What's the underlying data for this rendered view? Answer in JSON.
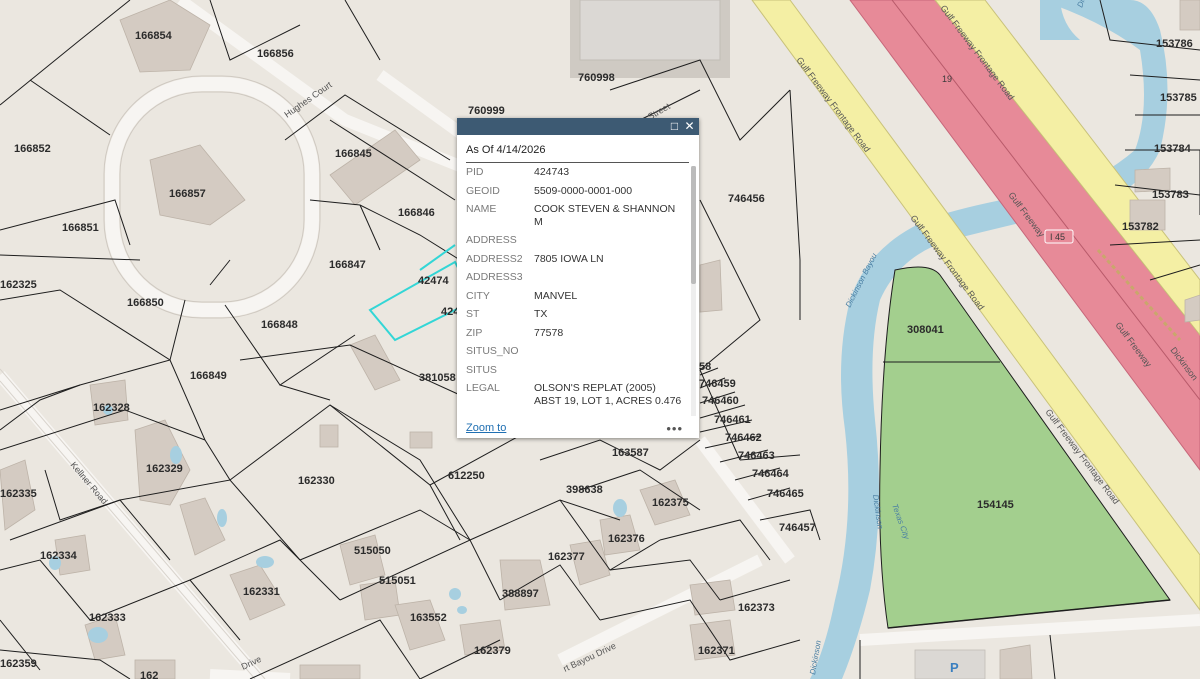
{
  "popup": {
    "title": "As Of 4/14/2026",
    "fields": [
      {
        "key": "PID",
        "value": "424743"
      },
      {
        "key": "GEOID",
        "value": "5509-0000-0001-000"
      },
      {
        "key": "NAME",
        "value": "COOK STEVEN & SHANNON M"
      },
      {
        "key": "ADDRESS",
        "value": ""
      },
      {
        "key": "ADDRESS2",
        "value": "7805 IOWA LN"
      },
      {
        "key": "ADDRESS3",
        "value": ""
      },
      {
        "key": "CITY",
        "value": "MANVEL"
      },
      {
        "key": "ST",
        "value": "TX"
      },
      {
        "key": "ZIP",
        "value": "77578"
      },
      {
        "key": "SITUS_NO",
        "value": ""
      },
      {
        "key": "SITUS",
        "value": ""
      },
      {
        "key": "LEGAL",
        "value": "OLSON'S REPLAT (2005) ABST 19, LOT 1, ACRES 0.476"
      }
    ],
    "zoom_label": "Zoom to",
    "more_label": "•••",
    "maximize_icon": "□",
    "close_icon": "✕"
  },
  "parcels": {
    "p166854": "166854",
    "p166856": "166856",
    "p760998": "760998",
    "p760999": "760999",
    "p166852": "166852",
    "p166857": "166857",
    "p166845": "166845",
    "p166846": "166846",
    "p166851": "166851",
    "p166847": "166847",
    "p162325": "162325",
    "p166850": "166850",
    "p166848": "166848",
    "p42474": "42474",
    "p424": "424",
    "p166849": "166849",
    "p381058": "381058",
    "p162328": "162328",
    "p162329": "162329",
    "p162330": "162330",
    "p162335": "162335",
    "p612250": "612250",
    "p163587": "163587",
    "p398638": "398638",
    "p162375": "162375",
    "p162376": "162376",
    "p162334": "162334",
    "p515050": "515050",
    "p515051": "515051",
    "p162377": "162377",
    "p388897": "388897",
    "p162331": "162331",
    "p162333": "162333",
    "p163552": "163552",
    "p162373": "162373",
    "p162379": "162379",
    "p162371": "162371",
    "p162359": "162359",
    "p162": "162",
    "p746456": "746456",
    "p58": "58",
    "p746459": "746459",
    "p746460": "746460",
    "p746461": "746461",
    "p746462": "746462",
    "p746463": "746463",
    "p746464": "746464",
    "p746465": "746465",
    "p746457": "746457",
    "p308041": "308041",
    "p154145": "154145",
    "p153786": "153786",
    "p153785": "153785",
    "p153784": "153784",
    "p153783": "153783",
    "p153782": "153782"
  },
  "roads": {
    "hughes_court": "Hughes Court",
    "kellner_road": "Kellner Road",
    "frontage_1": "Gulf Freeway Frontage Road",
    "frontage_2": "Gulf Freeway Frontage Road",
    "frontage_3": "Gulf Freeway Frontage Road",
    "frontage_4": "Gulf Freeway Frontage Road",
    "gulf_freeway": "Gulf Freeway",
    "gulf_freeway_2": "Gulf Freeway",
    "i45": "I 45",
    "shield_19": "19",
    "drive_partial": "Drive",
    "bayou_drive": "rt Bayou Drive",
    "street_partial": "Street",
    "dickinson_partial": "Dickinson"
  },
  "water": {
    "dickinson_bayou": "Dickinson Bayou",
    "dickinson_bayou_top": "Dickinson Bayou",
    "dickinson": "Dickinson",
    "texas_city": "Texas City",
    "dickinson_lower": "Dickinson"
  },
  "poi": {
    "parking": "P"
  },
  "colors": {
    "background": "#ebe7e0",
    "parcel_line": "#1e1e1e",
    "selected_parcel": "#33d6d6",
    "freeway": "#e78a98",
    "frontage_road": "#f4efa4",
    "water": "#a7cfe0",
    "park": "#a3cf8e",
    "building": "#d4cbc2",
    "popup_header": "#3d5a73",
    "link": "#1f6fb2"
  }
}
